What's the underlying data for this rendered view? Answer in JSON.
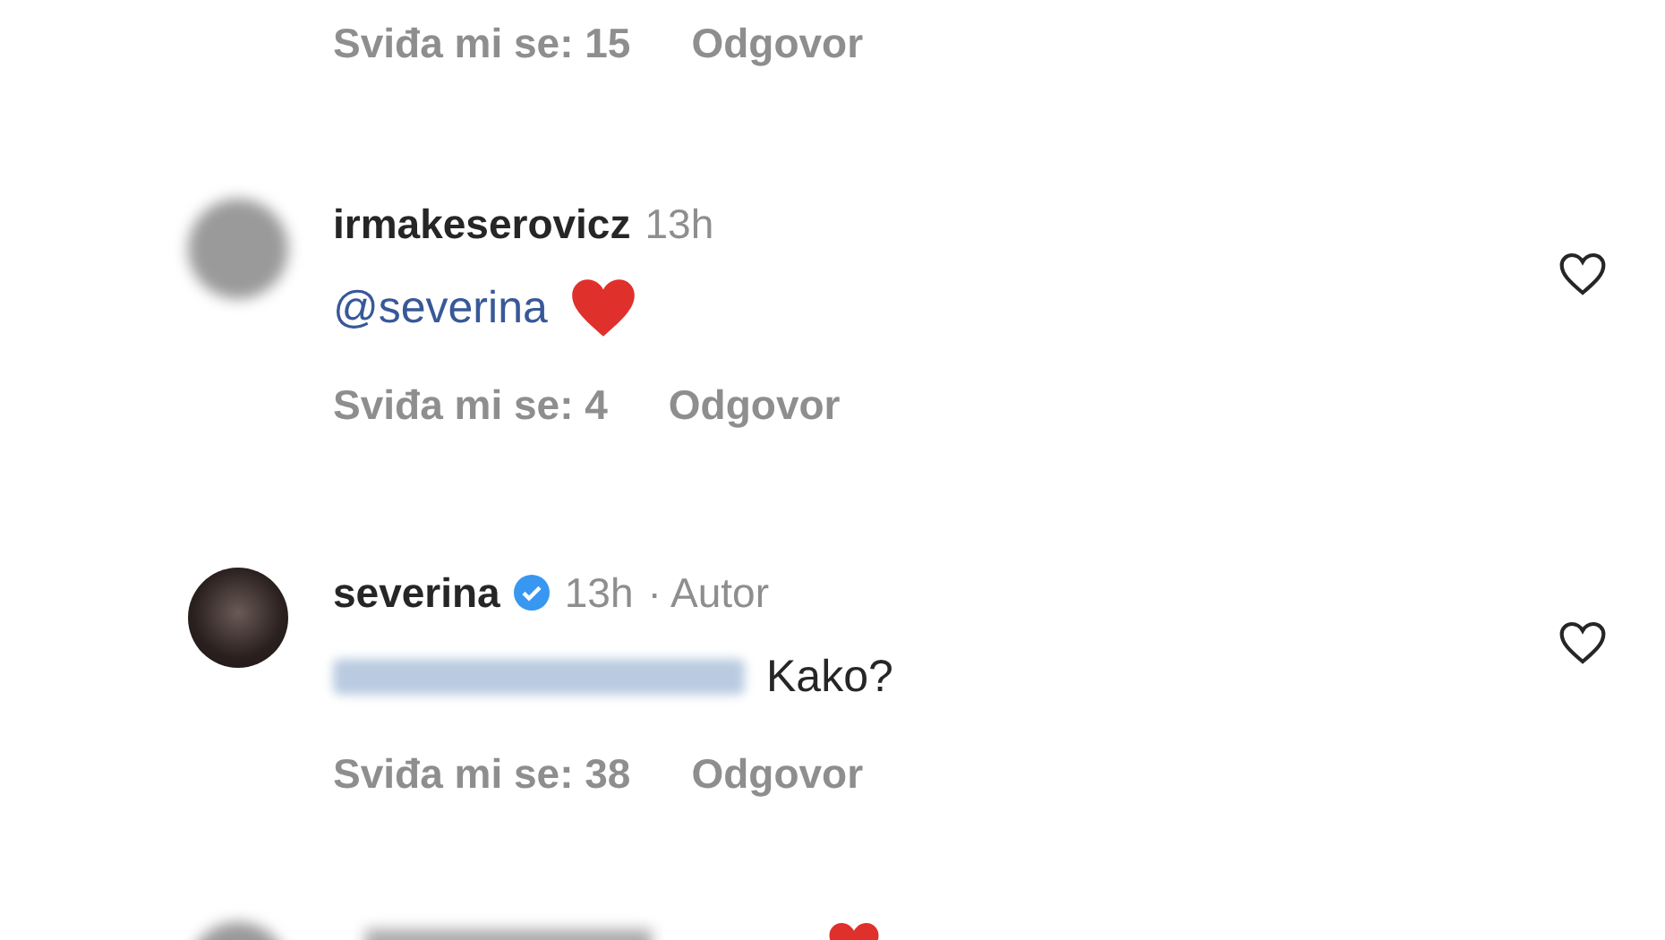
{
  "previous_comment_actions": {
    "likes": "Sviđa mi se: 15",
    "reply": "Odgovor"
  },
  "comments": [
    {
      "username": "irmakeserovicz",
      "verified": false,
      "time": "13h",
      "mention_blurred": false,
      "mention": "@severina",
      "heart_emoji": true,
      "avatar_blurred": true,
      "likes": "Sviđa mi se: 4",
      "reply": "Odgovor",
      "liked": false
    },
    {
      "username": "severina",
      "verified": true,
      "time": "13h",
      "author_label": "· Autor",
      "mention_blurred": true,
      "text": "Kako?",
      "heart_emoji": false,
      "avatar_blurred": false,
      "likes": "Sviđa mi se: 38",
      "reply": "Odgovor",
      "liked": false
    }
  ],
  "partial_comment": {
    "heart_emoji": true
  }
}
